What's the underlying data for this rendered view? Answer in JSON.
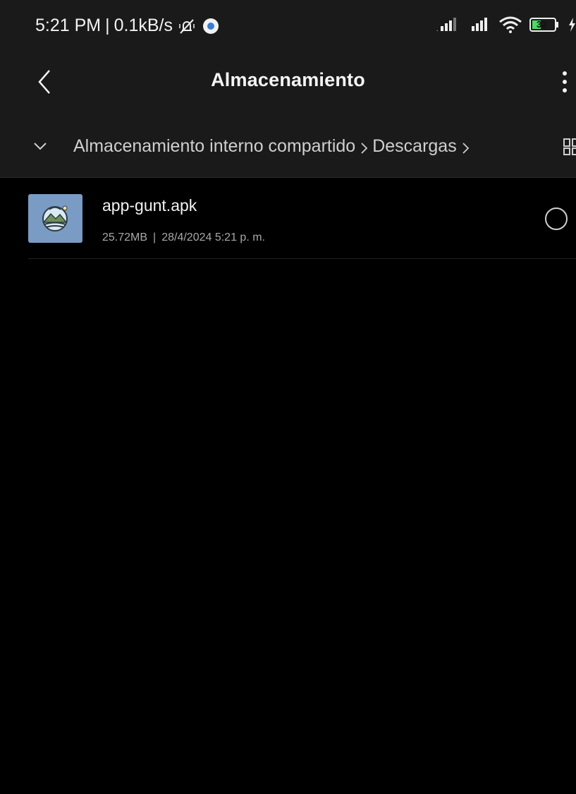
{
  "status_bar": {
    "time": "5:21 PM",
    "separator": "|",
    "net_speed": "0.1kB/s",
    "battery_level": "32",
    "icons": [
      "vibrate-muted-icon",
      "app-notification-icon",
      "signal-icon",
      "signal-icon",
      "wifi-icon",
      "battery-icon",
      "charging-icon"
    ]
  },
  "app_bar": {
    "title": "Almacenamiento",
    "back_icon": "chevron-left-icon",
    "more_icon": "vertical-dots-icon"
  },
  "breadcrumb": {
    "toggle_icon": "chevron-down-icon",
    "items": [
      "Almacenamiento interno compartido",
      "Descargas"
    ],
    "separator_icon": "chevron-right-icon",
    "view_toggle_icon": "grid-view-icon"
  },
  "files": [
    {
      "name": "app-gunt.apk",
      "size": "25.72MB",
      "divider": "|",
      "date": "28/4/2024 5:21 p. m.",
      "thumb_icon": "app-landscape-icon",
      "selected": false
    }
  ],
  "colors": {
    "background": "#000000",
    "bar_background": "#1a1a1a",
    "thumb_background": "#7a9bc3",
    "primary_text": "#f2f2f2",
    "secondary_text": "#a8a8a8"
  }
}
